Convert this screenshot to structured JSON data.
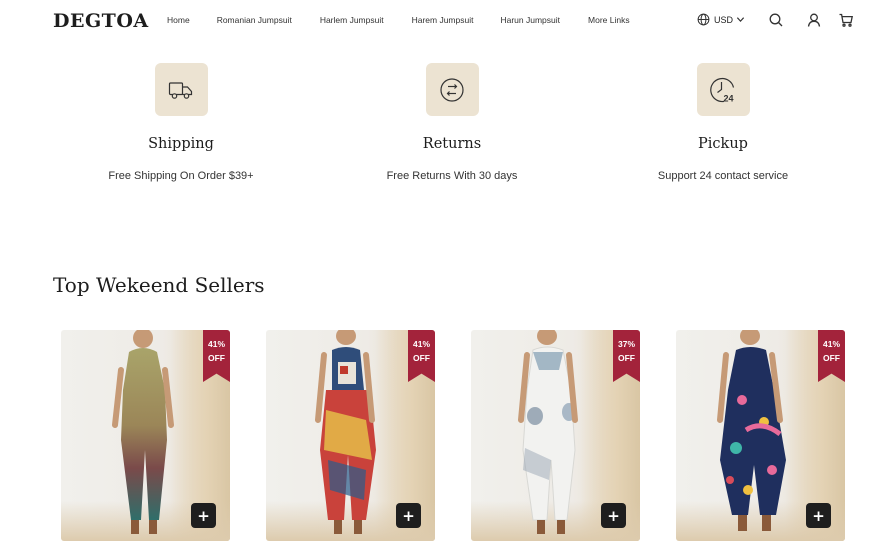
{
  "header": {
    "logo": "DEGTOA",
    "nav": [
      "Home",
      "Romanian Jumpsuit",
      "Harlem Jumpsuit",
      "Harem Jumpsuit",
      "Harun Jumpsuit",
      "More Links"
    ],
    "currency": "USD",
    "icons": [
      "globe-icon",
      "chevron-down-icon",
      "search-icon",
      "account-icon",
      "cart-icon"
    ]
  },
  "features": [
    {
      "icon": "truck-icon",
      "title": "Shipping",
      "desc": "Free Shipping On Order $39+"
    },
    {
      "icon": "exchange-icon",
      "title": "Returns",
      "desc": "Free Returns With 30 days"
    },
    {
      "icon": "clock-24-icon",
      "title": "Pickup",
      "desc": "Support 24 contact service"
    }
  ],
  "section_title": "Top Wekeend Sellers",
  "products": [
    {
      "badge_pct": "41%",
      "badge_off": "OFF",
      "add": "+"
    },
    {
      "badge_pct": "41%",
      "badge_off": "OFF",
      "add": "+"
    },
    {
      "badge_pct": "37%",
      "badge_off": "OFF",
      "add": "+"
    },
    {
      "badge_pct": "41%",
      "badge_off": "OFF",
      "add": "+"
    }
  ],
  "colors": {
    "accent_badge": "#a3233b",
    "icon_box": "#ece3d2"
  }
}
